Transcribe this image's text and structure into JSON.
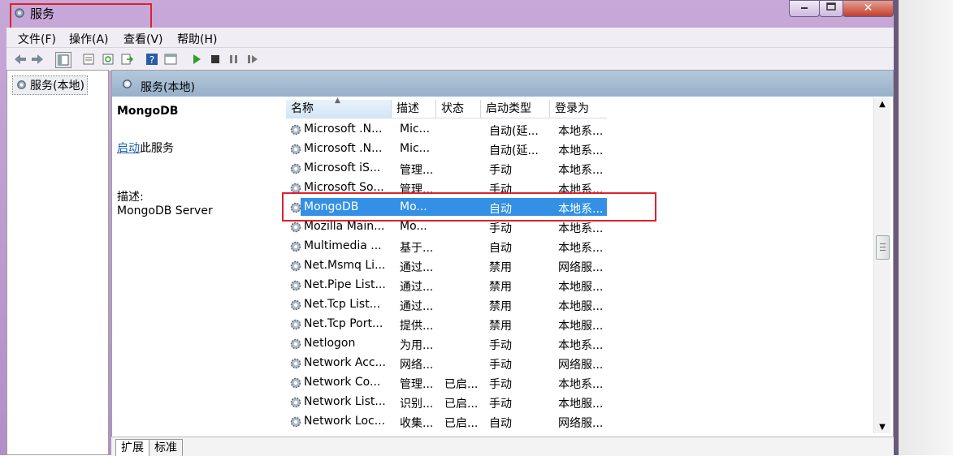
{
  "window": {
    "title": "服务"
  },
  "menu": [
    "文件(F)",
    "操作(A)",
    "查看(V)",
    "帮助(H)"
  ],
  "toolbar": [
    "back-icon",
    "forward-icon",
    "console-tree-icon",
    "properties-list-icon",
    "refresh-icon",
    "export-icon",
    "help-icon",
    "view-icon",
    "play-icon",
    "stop-icon",
    "pause-icon",
    "resume-icon"
  ],
  "tree": {
    "item": "服务(本地)"
  },
  "content": {
    "header": "服务(本地)"
  },
  "detail": {
    "service_name": "MongoDB",
    "start_link": "启动",
    "start_suffix": "此服务",
    "desc_label": "描述:",
    "desc_text": "MongoDB Server"
  },
  "table": {
    "columns": [
      "名称",
      "描述",
      "状态",
      "启动类型",
      "登录为"
    ],
    "rows": [
      [
        "Microsoft .N...",
        "Mic...",
        "",
        "自动(延...",
        "本地系..."
      ],
      [
        "Microsoft .N...",
        "Mic...",
        "",
        "自动(延...",
        "本地系..."
      ],
      [
        "Microsoft iS...",
        "管理...",
        "",
        "手动",
        "本地系..."
      ],
      [
        "Microsoft So...",
        "管理...",
        "",
        "手动",
        "本地系..."
      ],
      [
        "MongoDB",
        "Mo...",
        "",
        "自动",
        "本地系..."
      ],
      [
        "Mozilla Main...",
        "Mo...",
        "",
        "手动",
        "本地系..."
      ],
      [
        "Multimedia ...",
        "基于...",
        "",
        "自动",
        "本地系..."
      ],
      [
        "Net.Msmq Li...",
        "通过...",
        "",
        "禁用",
        "网络服..."
      ],
      [
        "Net.Pipe List...",
        "通过...",
        "",
        "禁用",
        "本地服..."
      ],
      [
        "Net.Tcp List...",
        "通过...",
        "",
        "禁用",
        "本地服..."
      ],
      [
        "Net.Tcp Port...",
        "提供...",
        "",
        "禁用",
        "本地服..."
      ],
      [
        "Netlogon",
        "为用...",
        "",
        "手动",
        "本地系..."
      ],
      [
        "Network Acc...",
        "网络...",
        "",
        "手动",
        "网络服..."
      ],
      [
        "Network Co...",
        "管理...",
        "已启...",
        "手动",
        "本地系..."
      ],
      [
        "Network List...",
        "识别...",
        "已启...",
        "手动",
        "本地服..."
      ],
      [
        "Network Loc...",
        "收集...",
        "已启...",
        "自动",
        "网络服..."
      ]
    ],
    "selected_index": 4
  },
  "tabs": [
    "扩展",
    "标准"
  ],
  "colors": {
    "selection": "#3390e5",
    "highlight_box": "#e0202a",
    "header": "#9fb6cc"
  }
}
